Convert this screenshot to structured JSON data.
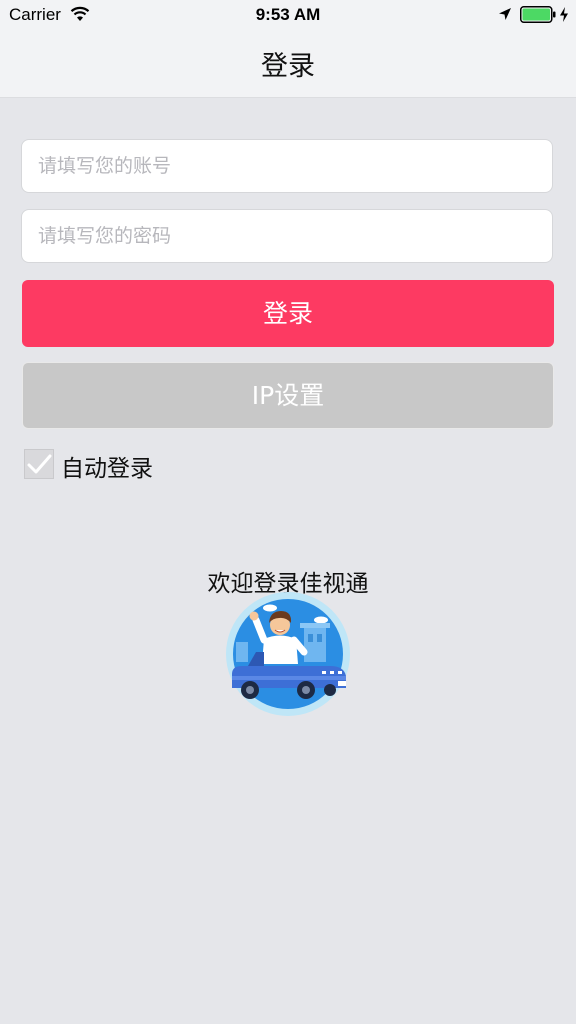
{
  "status_bar": {
    "carrier": "Carrier",
    "time": "9:53 AM",
    "icons": [
      "wifi-icon",
      "location-arrow-icon",
      "battery-icon",
      "charging-bolt-icon"
    ]
  },
  "nav": {
    "title": "登录"
  },
  "form": {
    "account_placeholder": "请填写您的账号",
    "password_placeholder": "请填写您的密码",
    "login_label": "登录",
    "ip_settings_label": "IP设置",
    "auto_login_label": "自动登录",
    "auto_login_checked": true
  },
  "welcome": {
    "text": "欢迎登录佳视通"
  },
  "colors": {
    "background": "#e5e6ea",
    "bar": "#f2f3f5",
    "login_button": "#fd3a62",
    "ip_button": "#c8c8c8",
    "battery": "#4cd964"
  }
}
